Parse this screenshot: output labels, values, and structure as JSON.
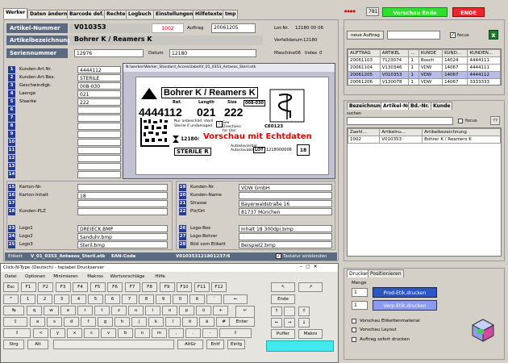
{
  "tabs": [
    "Werker",
    "Daten ändern",
    "Barcode def.",
    "Rechte",
    "Logbuch",
    "Einstellungen",
    "Hilfetexte",
    "tmp"
  ],
  "top": {
    "counter": "781",
    "status_green": "Vorschau Ende",
    "status_red": "ENDE"
  },
  "header": {
    "artnr_label": "Artikel-Nummer",
    "artnr": "V010353",
    "count": "1002",
    "auftrag_label": "Auftrag",
    "auftrag": "20061205",
    "lotnr_label": "Lot-Nr.",
    "lotnr": "12180 00 06",
    "bez_label": "Artikelbezeichnung",
    "bez": "Bohrer K / Reamers K",
    "verfall_label": "Verfalldatum",
    "verfall": "12180",
    "serien_label": "Seriennummer",
    "serien": "12976",
    "datum_label": "Datum",
    "datum": "12180",
    "maschine_label": "Maschine",
    "maschine": "06",
    "index_label": "Index",
    "index": "0"
  },
  "left_fields": [
    {
      "n": "1",
      "label": "Kunden-Art.Nr.",
      "value": "4444112"
    },
    {
      "n": "2",
      "label": "Kunden-Art.Bez.",
      "value": "STERILE"
    },
    {
      "n": "3",
      "label": "Geschwindigk.",
      "value": "008-030"
    },
    {
      "n": "4",
      "label": "Laenge",
      "value": "021"
    },
    {
      "n": "5",
      "label": "Staerke",
      "value": "222"
    },
    {
      "n": "6",
      "label": "",
      "value": ""
    },
    {
      "n": "7",
      "label": "",
      "value": ""
    },
    {
      "n": "8",
      "label": "",
      "value": ""
    },
    {
      "n": "9",
      "label": "",
      "value": ""
    },
    {
      "n": "10",
      "label": "",
      "value": ""
    },
    {
      "n": "11",
      "label": "",
      "value": ""
    },
    {
      "n": "12",
      "label": "",
      "value": ""
    },
    {
      "n": "13",
      "label": "",
      "value": ""
    },
    {
      "n": "14",
      "label": "",
      "value": ""
    }
  ],
  "bottom_left": [
    {
      "n": "15",
      "label": "Karton-Nr.",
      "value": ""
    },
    {
      "n": "16",
      "label": "Karton-Inhalt",
      "value": "18"
    },
    {
      "n": "17",
      "label": "",
      "value": ""
    },
    {
      "n": "18",
      "label": "Kunden-PLZ",
      "value": ""
    },
    {
      "n": "23",
      "label": "Logo1",
      "value": "DREIECK.BMP"
    },
    {
      "n": "24",
      "label": "Logo2",
      "value": "Sanduhr.bmp"
    },
    {
      "n": "25",
      "label": "Logo3",
      "value": "Steril.bmp"
    }
  ],
  "bottom_right": [
    {
      "n": "19",
      "label": "Kunden-Nr.",
      "value": "VDW GmbH"
    },
    {
      "n": "20",
      "label": "Kunden-Name",
      "value": ""
    },
    {
      "n": "21",
      "label": "Strasse",
      "value": "Bayerwaldstraße 16"
    },
    {
      "n": "22",
      "label": "Plz/Ort",
      "value": "81737 München"
    },
    {
      "n": "26",
      "label": "Logo-Box",
      "value": "Inhalt 18 300dpi.bmp"
    },
    {
      "n": "27",
      "label": "Logo-Bohrer",
      "value": ""
    },
    {
      "n": "28",
      "label": "Bild vom Etikett",
      "value": "Beispiel2.bmp"
    }
  ],
  "footer": {
    "etikett_label": "Etikett",
    "etikett": "V_01_0353_Antaeos_Steril.etk",
    "ean_label": "EAN-Code",
    "ean": "V010353121801237/6",
    "tastatur": "Tastatur einblenden"
  },
  "preview": {
    "path": "N:\\werker\\Werker_Standard_Access\\label\\V_01_0353_Antaeos_Steril.etk",
    "title": "Bohrer K / Reamers K",
    "ref_label": "Ref.",
    "ref": "4444112",
    "length_label": "Length",
    "length": "021",
    "size_label": "Size",
    "size": "222",
    "size_range": "008-030",
    "note1": "Nur unbeschäd. steril",
    "note2": "Sterile if undamaged",
    "see": "See Directions for Use",
    "lot_code": "12180:",
    "sterile": "STERILE R",
    "vorschau": "Vorschau mit Echtdaten",
    "ce": "CE0123",
    "lot_label": "LOT",
    "lot": "1218000006",
    "box": "18",
    "autoklav1": "Autoklavierbar",
    "autoklav2": "Autoclavable"
  },
  "right": {
    "auftrag_btn": "neue Auftrag",
    "focus": "focus",
    "table_headers": [
      "AUFTRAG",
      "ARTIKEL",
      "...",
      "KUNDE",
      "KUND...",
      "KUNDEN..."
    ],
    "orders": [
      [
        "20061103",
        "7123074",
        "1",
        "Bosch",
        "14024",
        "4444111"
      ],
      [
        "20061104",
        "V130346",
        "1",
        "VDW",
        "14067",
        "4444111"
      ],
      [
        "20061205",
        "V010353",
        "1",
        "VDW",
        "14067",
        "4444112"
      ],
      [
        "20061206",
        "V130078",
        "1",
        "VDW",
        "14067",
        "3333333"
      ]
    ],
    "subtabs": [
      "Bezeichnung",
      "Artikel-Nr.",
      "Bd.-Nr.",
      "Kunde"
    ],
    "suchen": "suchen",
    "focus2": "focus",
    "search_headers": [
      "Zaehl...",
      "Artikelnu...",
      "Artikelbezeichnung"
    ],
    "search_rows": [
      [
        "1002",
        "V010353",
        "Bohrer K / Reamers K"
      ]
    ]
  },
  "print": {
    "tabs": [
      "Drucken",
      "Positionieren"
    ],
    "menge_label": "Menge",
    "menge1": "1",
    "menge2": "1",
    "btn1": "Prod-Etik.drucken",
    "btn2": "Verp-Etik.drucken",
    "opt1": "Vorschau Etikettenmaterial",
    "opt2": "Vorschau Layout",
    "opt3": "Auftrag sofort drucken"
  },
  "keyboard": {
    "title": "Click-N-Type (Deutsch) - toplabel Druckserver",
    "menu": [
      "Datei",
      "Optionen",
      "Minimieren",
      "Makros",
      "Wortvorschläge",
      "Hilfe"
    ],
    "row1": [
      "Esc",
      "F1",
      "F2",
      "F3",
      "F4",
      "F5",
      "F6",
      "F7",
      "F8",
      "F9",
      "F10",
      "F11",
      "F12"
    ],
    "row2": [
      "^",
      "1",
      "2",
      "3",
      "4",
      "5",
      "6",
      "7",
      "8",
      "9",
      "0",
      "ß",
      "´",
      "←"
    ],
    "row3": [
      "↹",
      "q",
      "w",
      "e",
      "r",
      "t",
      "z",
      "u",
      "i",
      "o",
      "p",
      "ü",
      "+"
    ],
    "row4": [
      "⇪",
      "a",
      "s",
      "d",
      "f",
      "g",
      "h",
      "j",
      "k",
      "l",
      "ö",
      "ä",
      "#",
      "Enter"
    ],
    "row5": [
      "⇧",
      "<",
      "y",
      "x",
      "c",
      "v",
      "b",
      "n",
      "m",
      ",",
      ".",
      "-",
      "⇧"
    ],
    "row6": [
      "Strg",
      "Alt",
      "",
      "AltGr",
      "Entf",
      "Einfg"
    ],
    "nav": [
      "Ende",
      "Pfeil"
    ],
    "aufgabe": "Puffer",
    "makro": "Makro"
  },
  "colors": {
    "navy": "#243c8c",
    "green": "#2ee02e",
    "red": "#e8282d",
    "slate": "#5b6a80",
    "blue_btn": "#2c55c8"
  }
}
